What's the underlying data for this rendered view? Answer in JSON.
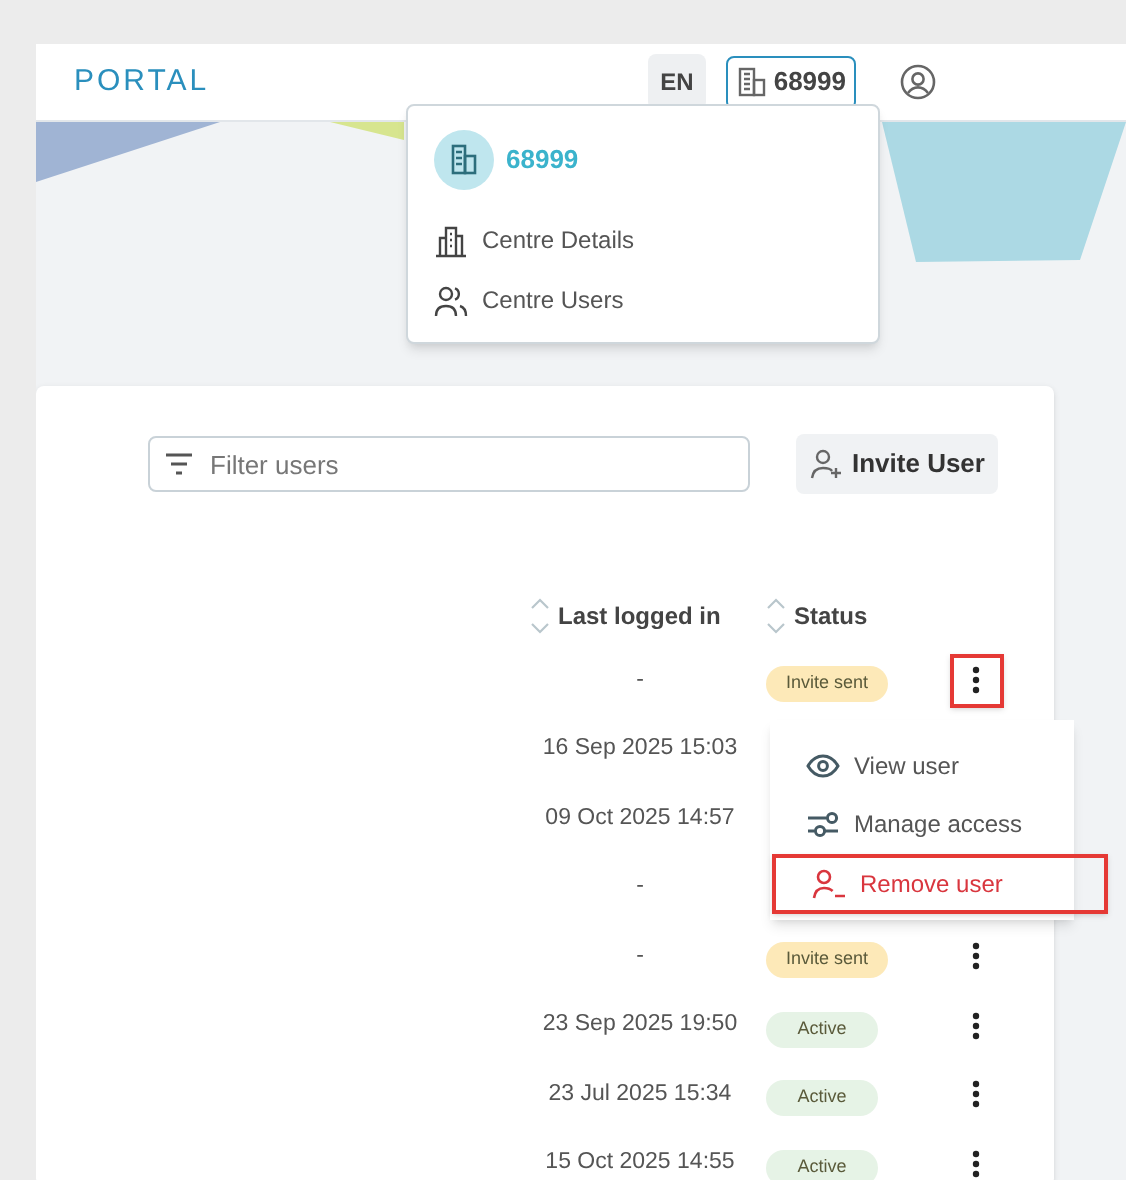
{
  "header": {
    "logo": "PORTAL",
    "language": "EN",
    "centre_button": "68999"
  },
  "centre_menu": {
    "title": "68999",
    "items": [
      {
        "kind": "details",
        "label": "Centre Details"
      },
      {
        "kind": "users",
        "label": "Centre Users"
      }
    ]
  },
  "toolbar": {
    "filter": {
      "placeholder": "Filter users"
    },
    "invite_button": "Invite User"
  },
  "table": {
    "columns": [
      "Last logged in",
      "Status"
    ],
    "rows": [
      {
        "last_logged_in": "-",
        "status": "Invite sent",
        "color": "#fde9b8",
        "highlighted": true
      },
      {
        "last_logged_in": "16 Sep 2025 15:03"
      },
      {
        "last_logged_in": "09 Oct 2025 14:57"
      },
      {
        "last_logged_in": "-"
      },
      {
        "last_logged_in": "-",
        "status": "Invite sent",
        "color": "#fde9b8",
        "highlighted": false
      },
      {
        "last_logged_in": "23 Sep 2025 19:50",
        "status": "Active",
        "color": "#e6f3e6",
        "highlighted": false
      },
      {
        "last_logged_in": "23 Jul 2025 15:34",
        "status": "Active",
        "color": "#e6f3e6",
        "highlighted": false
      },
      {
        "last_logged_in": "15 Oct 2025 14:55",
        "status": "Active",
        "color": "#e6f3e6",
        "highlighted": false
      }
    ]
  },
  "row_menu": {
    "items": [
      {
        "kind": "view",
        "label": "View user",
        "highlighted": false
      },
      {
        "kind": "access",
        "label": "Manage access",
        "highlighted": false
      },
      {
        "kind": "remove",
        "label": "Remove user",
        "highlighted": true
      }
    ]
  }
}
